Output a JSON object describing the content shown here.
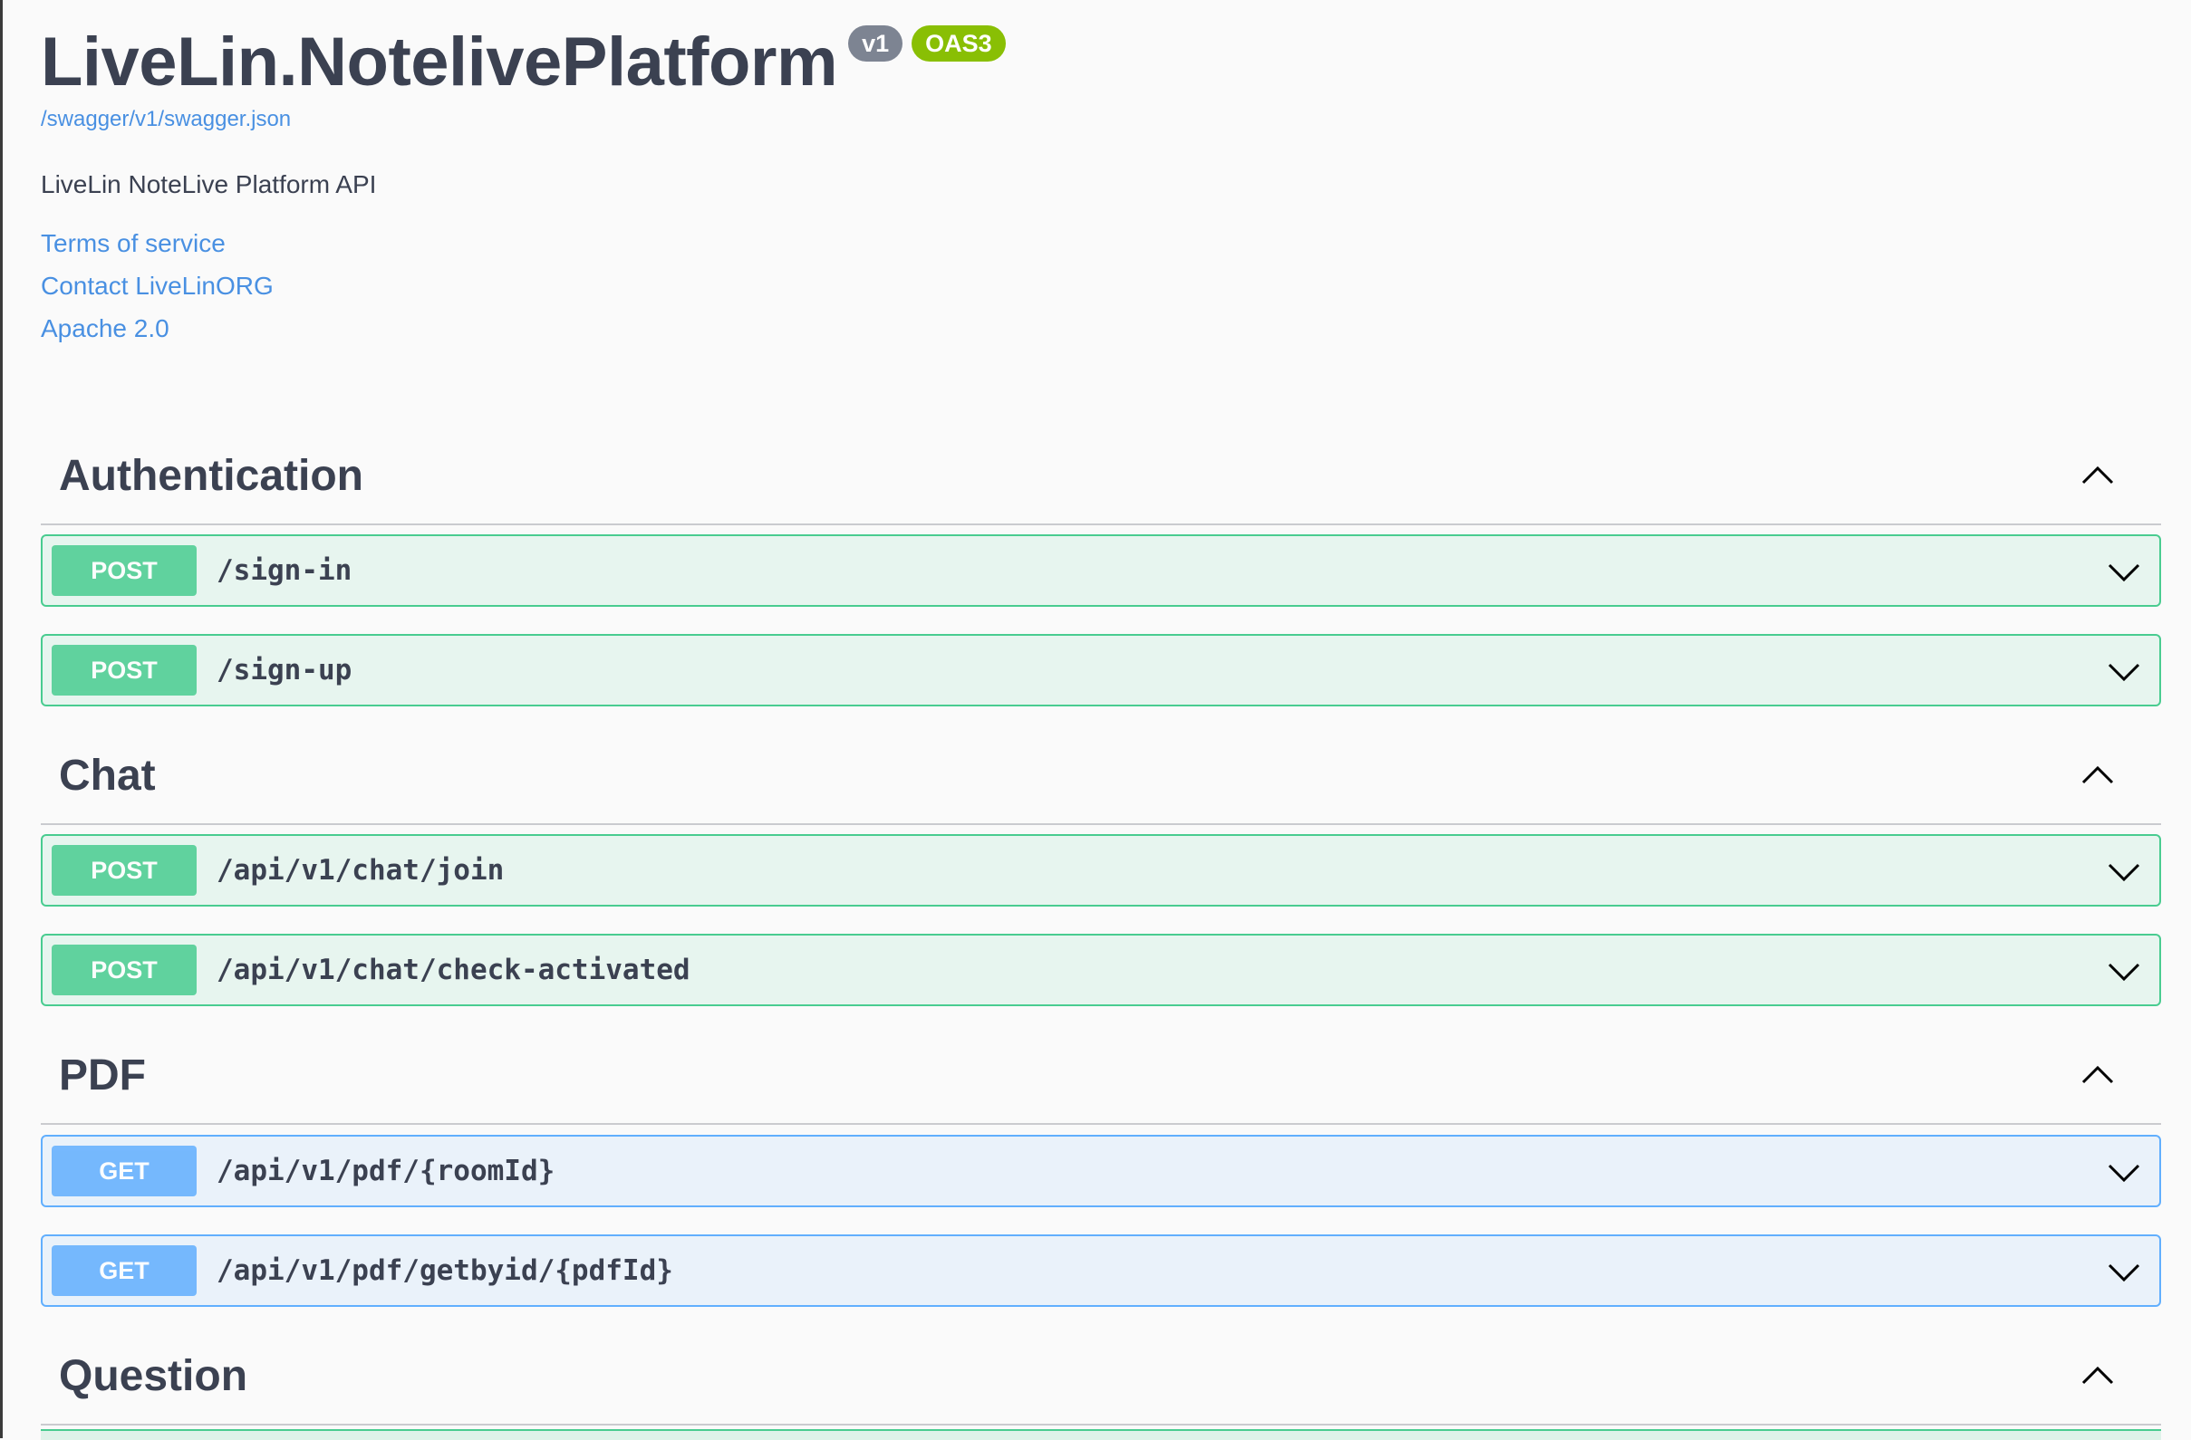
{
  "info": {
    "title": "LiveLin.NotelivePlatform",
    "version_badge": "v1",
    "oas_badge": "OAS3",
    "spec_url": "/swagger/v1/swagger.json",
    "description": "LiveLin NoteLive Platform API",
    "terms": "Terms of service",
    "contact": "Contact LiveLinORG",
    "license": "Apache 2.0"
  },
  "tags": [
    {
      "name": "Authentication",
      "operations": [
        {
          "method": "POST",
          "path": "/sign-in"
        },
        {
          "method": "POST",
          "path": "/sign-up"
        }
      ]
    },
    {
      "name": "Chat",
      "operations": [
        {
          "method": "POST",
          "path": "/api/v1/chat/join"
        },
        {
          "method": "POST",
          "path": "/api/v1/chat/check-activated"
        }
      ]
    },
    {
      "name": "PDF",
      "operations": [
        {
          "method": "GET",
          "path": "/api/v1/pdf/{roomId}"
        },
        {
          "method": "GET",
          "path": "/api/v1/pdf/getbyid/{pdfId}"
        }
      ]
    },
    {
      "name": "Question",
      "operations": []
    }
  ],
  "colors": {
    "post": "#49cc90",
    "get": "#61affe",
    "link": "#4990e2",
    "text": "#3b4151",
    "oas_badge": "#89bf04",
    "version_badge": "#7d8492"
  },
  "icons": {
    "tag_toggle": "chevron-up-icon",
    "op_toggle": "chevron-down-icon"
  }
}
